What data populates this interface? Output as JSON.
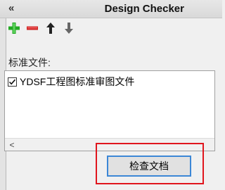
{
  "titlebar": {
    "collapse_glyph": "«",
    "title": "Design Checker"
  },
  "toolbar": {
    "buttons": [
      {
        "icon": "plus-icon",
        "color": "#22aa22"
      },
      {
        "icon": "minus-icon",
        "color": "#cc2020"
      },
      {
        "icon": "arrow-up-icon",
        "color": "#222222"
      },
      {
        "icon": "arrow-down-icon",
        "color": "#555555"
      }
    ]
  },
  "standards": {
    "label": "标准文件:",
    "items": [
      {
        "label": "YDSF工程图标准审图文件",
        "checked": true
      }
    ]
  },
  "scrollbar": {
    "left_glyph": "<"
  },
  "actions": {
    "check_document": "检查文档"
  },
  "colors": {
    "highlight": "#e0151d",
    "button_focus": "#3c87d6"
  }
}
